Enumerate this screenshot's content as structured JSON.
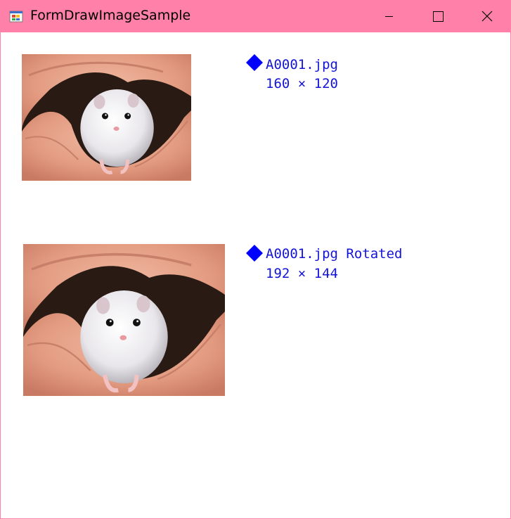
{
  "window": {
    "title": "FormDrawImageSample",
    "title_bar_color": "#ff80a8",
    "icon": "winforms-app-icon",
    "controls": {
      "minimize": "minimize-icon",
      "maximize": "maximize-icon",
      "close": "close-icon"
    }
  },
  "images": [
    {
      "file_label": "A0001.jpg",
      "size_label": "160 × 120",
      "marker": "diamond-icon",
      "content": "hamster-in-hands-photo"
    },
    {
      "file_label": "A0001.jpg Rotated",
      "size_label": "192 × 144",
      "marker": "diamond-icon",
      "content": "hamster-in-hands-photo"
    }
  ],
  "colors": {
    "caption_text": "#1414d6",
    "marker": "#0000ff"
  }
}
